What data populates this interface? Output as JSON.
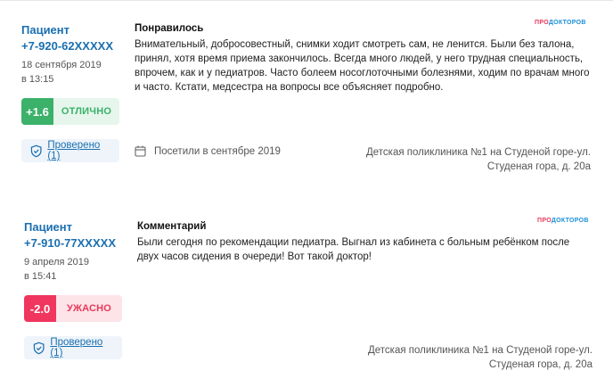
{
  "reviews": [
    {
      "author": "Пациент",
      "phone": "+7-920-62XXXXX",
      "date": "18 сентября 2019",
      "time": "в 13:15",
      "score": "+1.6",
      "rating_label": "ОТЛИЧНО",
      "verified_label": "Проверено (1)",
      "section_title": "Понравилось",
      "text": "Внимательный, добросовестный, снимки ходит смотреть сам, не ленится. Были без талона, принял, хотя время приема закончилось. Всегда много людей, у него трудная специальность, впрочем, как и у педиатров. Часто болеем носоглоточными болезнями, ходим по врачам много и часто. Кстати, медсестра на вопросы все объясняет подробно.",
      "visit": "Посетили в сентябре 2019",
      "clinic": "Детская поликлиника №1 на Студеной горе-ул. Студеная гора, д. 20а"
    },
    {
      "author": "Пациент",
      "phone": "+7-910-77XXXXX",
      "date": "9 апреля 2019",
      "time": "в 15:41",
      "score": "-2.0",
      "rating_label": "УЖАСНО",
      "verified_label": "Проверено (1)",
      "section_title": "Комментарий",
      "text": "Были сегодня по рекомендации педиатра. Выгнал из кабинета с больным ребёнком после двух часов сидения в очереди! Вот такой доктор!",
      "clinic": "Детская поликлиника №1 на Студеной горе-ул. Студеная гора, д. 20а"
    }
  ],
  "logo": {
    "part1": "ПРО",
    "part2": "ДОКТОРОВ"
  },
  "colors": {
    "link": "#1a6fb0",
    "good": "#3bb16a",
    "bad": "#f0365e"
  }
}
